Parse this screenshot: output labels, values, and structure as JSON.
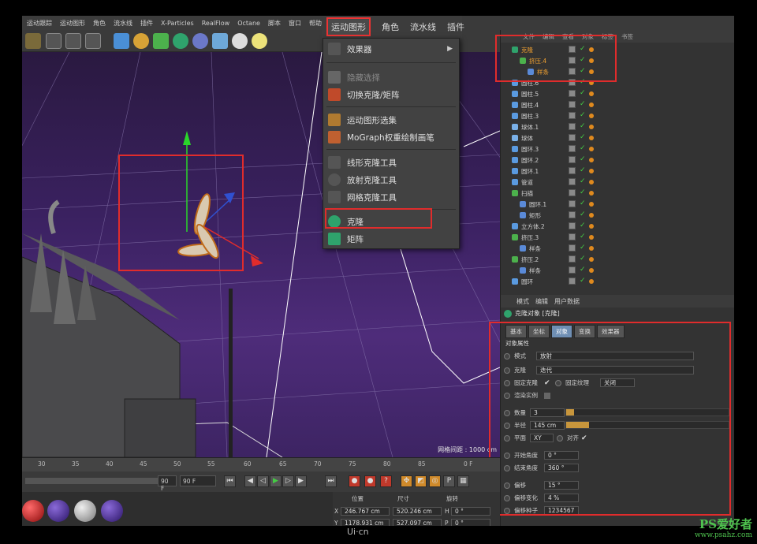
{
  "menu": {
    "items": [
      "运动跟踪",
      "运动图形",
      "角色",
      "流水线",
      "插件",
      "X-Particles",
      "RealFlow",
      "Octane",
      "脚本",
      "窗口",
      "帮助"
    ],
    "enlarged": [
      "运动图形",
      "角色",
      "流水线",
      "插件"
    ],
    "active_item": "运动图形"
  },
  "dropdown": {
    "effector": "效果器",
    "hide_selection": "隐藏选择",
    "toggle_clone": "切换克隆/矩阵",
    "mograph_selection": "运动图形选集",
    "mograph_weight": "MoGraph权重绘制画笔",
    "linear_clone": "线形克隆工具",
    "radial_clone": "放射克隆工具",
    "grid_clone": "网格克隆工具",
    "cloner": "克隆",
    "matrix": "矩阵"
  },
  "viewport": {
    "grid_spacing": "网格间距 : 1000 cm"
  },
  "object_manager": {
    "header": [
      "文件",
      "编辑",
      "查看",
      "对象",
      "标签",
      "书签"
    ],
    "objects": [
      {
        "name": "克隆",
        "level": 0,
        "icon": "cloner-icon",
        "highlight": true
      },
      {
        "name": "挤压.4",
        "level": 1,
        "icon": "extrude-icon",
        "highlight": true
      },
      {
        "name": "样条",
        "level": 2,
        "icon": "spline-icon",
        "highlight": true
      },
      {
        "name": "圆柱.6",
        "level": 0,
        "icon": "cylinder-icon"
      },
      {
        "name": "圆柱.5",
        "level": 0,
        "icon": "cylinder-icon"
      },
      {
        "name": "圆柱.4",
        "level": 0,
        "icon": "cylinder-icon"
      },
      {
        "name": "圆柱.3",
        "level": 0,
        "icon": "cylinder-icon"
      },
      {
        "name": "球体.1",
        "level": 0,
        "icon": "null-icon"
      },
      {
        "name": "球体",
        "level": 0,
        "icon": "null-icon"
      },
      {
        "name": "圆环.3",
        "level": 0,
        "icon": "torus-icon"
      },
      {
        "name": "圆环.2",
        "level": 0,
        "icon": "torus-icon"
      },
      {
        "name": "圆环.1",
        "level": 0,
        "icon": "torus-icon"
      },
      {
        "name": "管道",
        "level": 0,
        "icon": "tube-icon"
      },
      {
        "name": "扫描",
        "level": 0,
        "icon": "sweep-icon"
      },
      {
        "name": "圆环.1",
        "level": 1,
        "icon": "circle-icon"
      },
      {
        "name": "矩形",
        "level": 1,
        "icon": "rectangle-icon"
      },
      {
        "name": "立方体.2",
        "level": 0,
        "icon": "cube-icon"
      },
      {
        "name": "挤压.3",
        "level": 0,
        "icon": "extrude-icon"
      },
      {
        "name": "样条",
        "level": 1,
        "icon": "spline-icon"
      },
      {
        "name": "挤压.2",
        "level": 0,
        "icon": "extrude-icon"
      },
      {
        "name": "样条",
        "level": 1,
        "icon": "spline-icon"
      },
      {
        "name": "圆环",
        "level": 0,
        "icon": "torus-icon"
      }
    ]
  },
  "attributes": {
    "header": [
      "模式",
      "编辑",
      "用户数据"
    ],
    "title": "克隆对象 [克隆]",
    "tabs": [
      "基本",
      "坐标",
      "对象",
      "变换",
      "效果器"
    ],
    "active_tab": "对象",
    "section": "对象属性",
    "mode_label": "模式",
    "mode_value": "放射",
    "clones_label": "克隆",
    "clones_value": "迭代",
    "fix_clone_label": "固定克隆",
    "fix_texture_label": "固定纹理",
    "fix_texture_value": "关闭",
    "render_instances_label": "渲染实例",
    "count_label": "数量",
    "count_value": "3",
    "count_fill": 0.05,
    "radius_label": "半径",
    "radius_value": "145 cm",
    "radius_fill": 0.14,
    "plane_label": "平面",
    "plane_value": "XY",
    "align_label": "对齐",
    "start_angle_label": "开始角度",
    "start_angle_value": "0 °",
    "end_angle_label": "结束角度",
    "end_angle_value": "360 °",
    "offset_label": "偏移",
    "offset_value": "15 °",
    "offset_var_label": "偏移变化",
    "offset_var_value": "4 %",
    "offset_seed_label": "偏移种子",
    "offset_seed_value": "1234567"
  },
  "timeline": {
    "ticks": [
      "30",
      "35",
      "40",
      "45",
      "50",
      "55",
      "60",
      "65",
      "70",
      "75",
      "80",
      "85"
    ],
    "current_frame": "0 F",
    "end_frame": "90 F",
    "end_frame_field": "90 F"
  },
  "coordinates": {
    "headers": [
      "位置",
      "尺寸",
      "旋转"
    ],
    "x_pos": "246.767 cm",
    "x_size": "520.246 cm",
    "h_rot": "0 °",
    "y_pos": "1178.931 cm",
    "y_size": "527.097 cm",
    "p_rot": "0 °",
    "x_label": "X",
    "y_label": "Y",
    "h_label": "H",
    "p_label": "P"
  },
  "watermark": {
    "brand": "PS爱好者",
    "url": "www.psahz.com",
    "footer": "Ui·cn"
  },
  "colors": {
    "accent_red": "#e02c2c",
    "active_tab": "#6f8fb4",
    "check_green": "#44cc44",
    "tag_orange": "#e08a1e"
  }
}
